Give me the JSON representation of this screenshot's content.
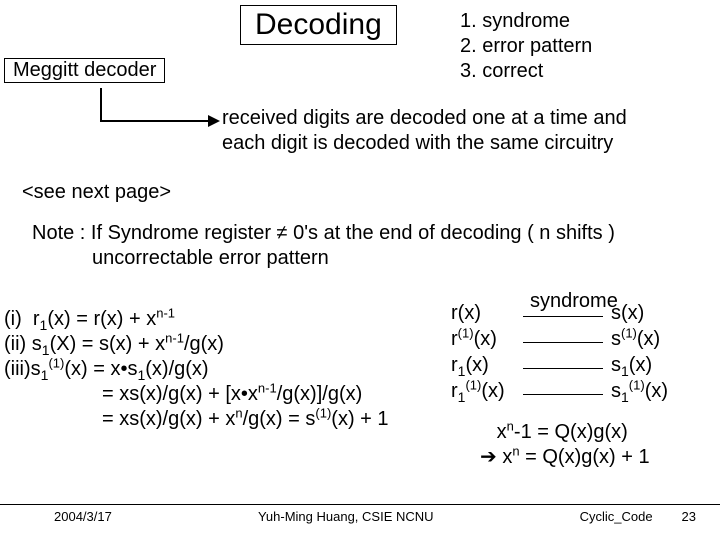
{
  "title": "Decoding",
  "steps": {
    "s1": "1.  syndrome",
    "s2": "2.  error pattern",
    "s3": "3.  correct"
  },
  "meggitt": "Meggitt decoder",
  "received": {
    "l1": "received digits are decoded one at a time and",
    "l2": "each digit is decoded with the same circuitry"
  },
  "see_next": "<see next page>",
  "note": {
    "l1": "Note : If Syndrome register ≠ 0's at the end of decoding ( n shifts )",
    "l2": "uncorrectable error pattern"
  },
  "syndrome_label": "syndrome",
  "map": {
    "r0": "r(x)",
    "s0": "s(x)",
    "r1": "r",
    "s1": "s",
    "r2": "r",
    "s2": "s",
    "r3": "r",
    "s3": "s"
  },
  "bot_eq": {
    "l2b": "   x"
  },
  "footer": {
    "date": "2004/3/17",
    "author": "Yuh-Ming Huang, CSIE NCNU",
    "topic": "Cyclic_Code",
    "page": "23"
  }
}
